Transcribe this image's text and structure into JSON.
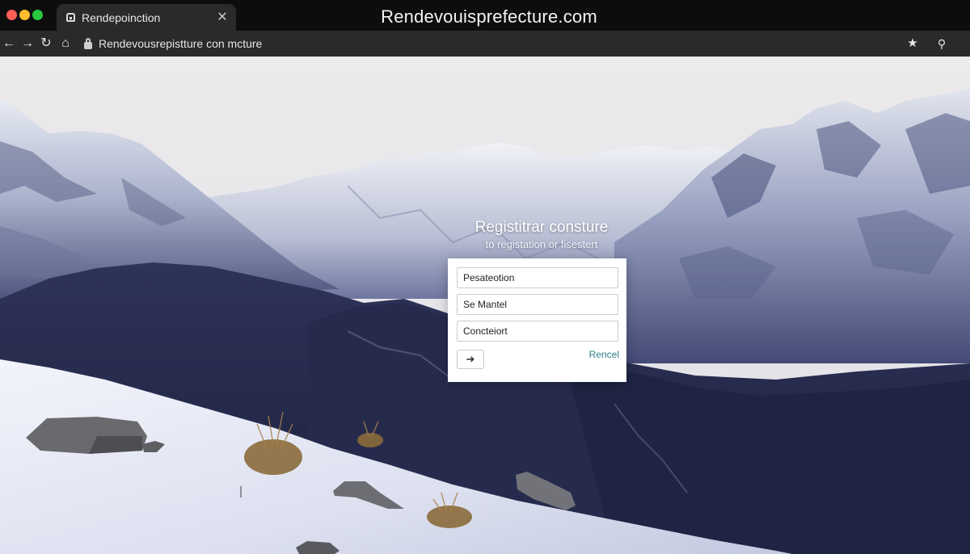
{
  "window": {
    "title": "Rendevouisprefecture.com",
    "controls": {
      "close_color": "#ff5f57",
      "minimize_color": "#febc2e",
      "maximize_color": "#28c840"
    }
  },
  "tab": {
    "title": "Rendepoinction",
    "icon": "home-icon",
    "close_symbol": "✕"
  },
  "toolbar": {
    "back_symbol": "←",
    "forward_symbol": "→",
    "reload_symbol": "↻",
    "home_symbol": "⌂",
    "url": "Rendevousrepistture con mcture",
    "bookmark_symbol": "★",
    "menu_symbol": "⚲"
  },
  "registration": {
    "heading": "Registitrar consture",
    "subheading": "to registation or fisestert",
    "fields": [
      {
        "placeholder": "Pesateotion"
      },
      {
        "placeholder": "Se Mantel"
      },
      {
        "placeholder": "Concteiort"
      }
    ],
    "submit_symbol": "➜",
    "cancel_label": "Rencel",
    "accent_color": "#2e7d86"
  }
}
